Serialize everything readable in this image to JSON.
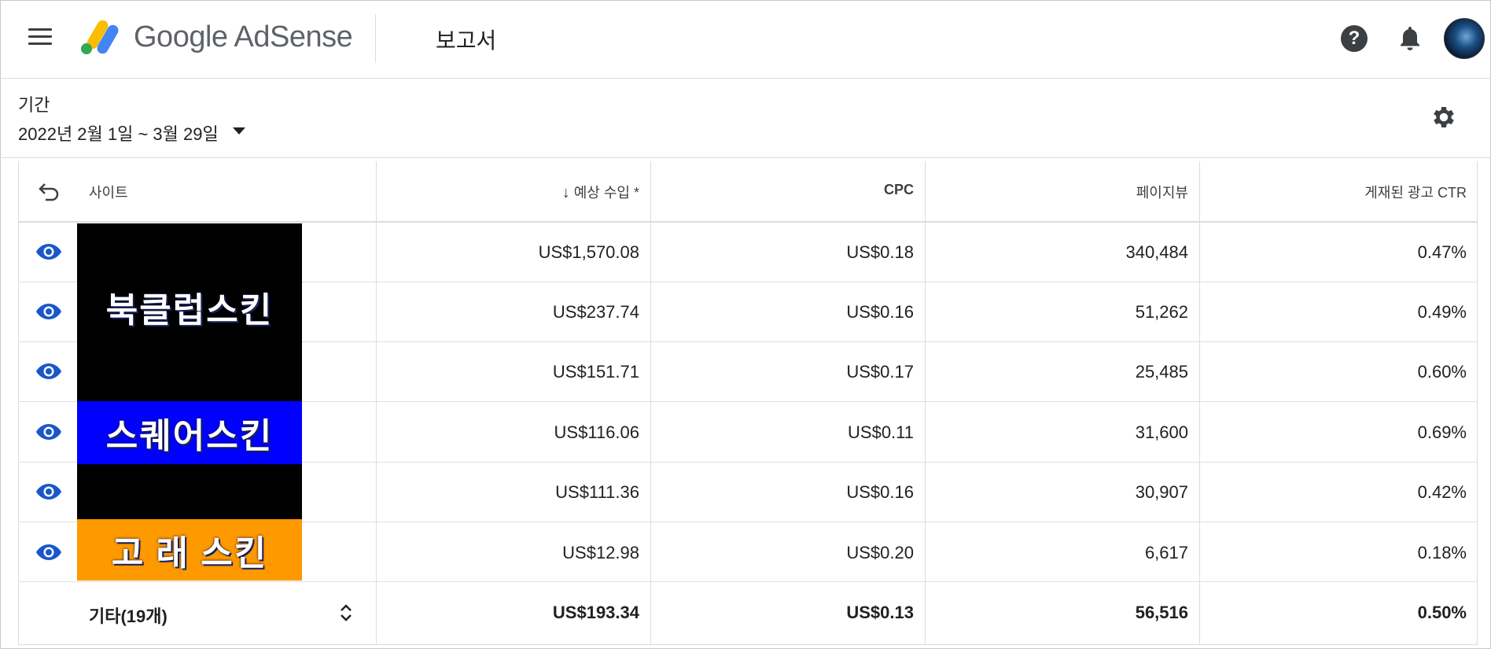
{
  "header": {
    "brand": "Google AdSense",
    "page_title": "보고서"
  },
  "filters": {
    "period_label": "기간",
    "period_value": "2022년 2월 1일 ~ 3월 29일"
  },
  "table": {
    "columns": [
      "사이트",
      "예상 수입 *",
      "CPC",
      "페이지뷰",
      "게재된 광고 CTR"
    ],
    "rows": [
      {
        "earnings": "US$1,570.08",
        "cpc": "US$0.18",
        "pageviews": "340,484",
        "ctr": "0.47%"
      },
      {
        "earnings": "US$237.74",
        "cpc": "US$0.16",
        "pageviews": "51,262",
        "ctr": "0.49%"
      },
      {
        "earnings": "US$151.71",
        "cpc": "US$0.17",
        "pageviews": "25,485",
        "ctr": "0.60%"
      },
      {
        "earnings": "US$116.06",
        "cpc": "US$0.11",
        "pageviews": "31,600",
        "ctr": "0.69%"
      },
      {
        "earnings": "US$111.36",
        "cpc": "US$0.16",
        "pageviews": "30,907",
        "ctr": "0.42%"
      },
      {
        "earnings": "US$12.98",
        "cpc": "US$0.20",
        "pageviews": "6,617",
        "ctr": "0.18%"
      }
    ],
    "other": {
      "label": "기타(19개)",
      "earnings": "US$193.34",
      "cpc": "US$0.13",
      "pageviews": "56,516",
      "ctr": "0.50%"
    }
  },
  "thumbnail": {
    "lines": [
      "북클럽스킨",
      "스퀘어스킨",
      "고 래 스킨"
    ]
  },
  "colors": {
    "accent": "#1a57c9",
    "thumb_blue": "#0000ff",
    "thumb_orange": "#ff9900",
    "thumb_black": "#000000"
  },
  "icons": [
    "menu-icon",
    "adsense-logo",
    "help-icon",
    "bell-icon",
    "avatar",
    "settings-gear-icon",
    "back-icon",
    "eye-icon",
    "sort-down-icon",
    "expand-icon"
  ]
}
